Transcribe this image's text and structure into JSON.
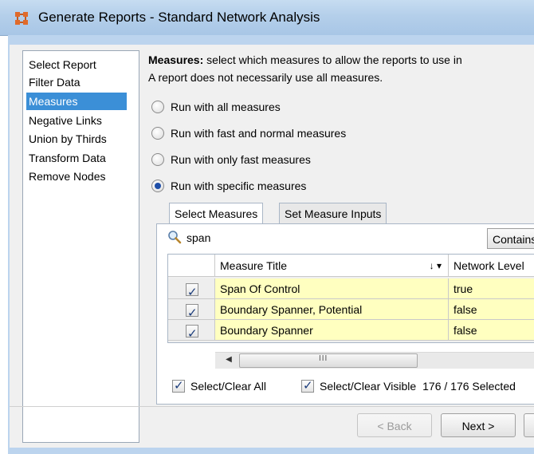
{
  "window": {
    "title": "Generate Reports - Standard Network Analysis"
  },
  "nav": {
    "items": [
      {
        "label": "Select Report"
      },
      {
        "label": "Filter Data"
      },
      {
        "label": "Measures",
        "selected": true
      },
      {
        "label": "Negative Links"
      },
      {
        "label": "Union by Thirds"
      },
      {
        "label": "Transform Data"
      },
      {
        "label": "Remove Nodes"
      }
    ]
  },
  "instructions": {
    "bold": "Measures:",
    "line1": " select which measures to allow the reports to use in",
    "line2": "A report does not necessarily use all measures."
  },
  "options": [
    {
      "label": "Run with all measures",
      "selected": false
    },
    {
      "label": "Run with fast and normal measures",
      "selected": false
    },
    {
      "label": "Run with only fast measures",
      "selected": false
    },
    {
      "label": "Run with specific measures",
      "selected": true
    }
  ],
  "tabs": [
    {
      "label": "Select Measures",
      "active": true
    },
    {
      "label": "Set Measure Inputs",
      "active": false
    }
  ],
  "search": {
    "value": "span",
    "mode_label": "Contains"
  },
  "table": {
    "headers": {
      "title": "Measure Title",
      "sort_indicator": "↓ ▾",
      "network": "Network Level"
    },
    "rows": [
      {
        "checked": true,
        "title": "Span Of Control",
        "network_level": "true"
      },
      {
        "checked": true,
        "title": "Boundary Spanner, Potential",
        "network_level": "false"
      },
      {
        "checked": true,
        "title": "Boundary Spanner",
        "network_level": "false"
      }
    ]
  },
  "scrollbar": {
    "left_arrow": "◀",
    "grip": "III"
  },
  "selection": {
    "select_all_label": "Select/Clear All",
    "select_visible_label": "Select/Clear Visible",
    "count_text": "176 / 176 Selected"
  },
  "footer": {
    "back_label": "< Back",
    "next_label": "Next >"
  },
  "colors": {
    "selection": "#3b8fd7",
    "row_highlight": "#ffffc0",
    "titlebar": "#b4cfea"
  }
}
